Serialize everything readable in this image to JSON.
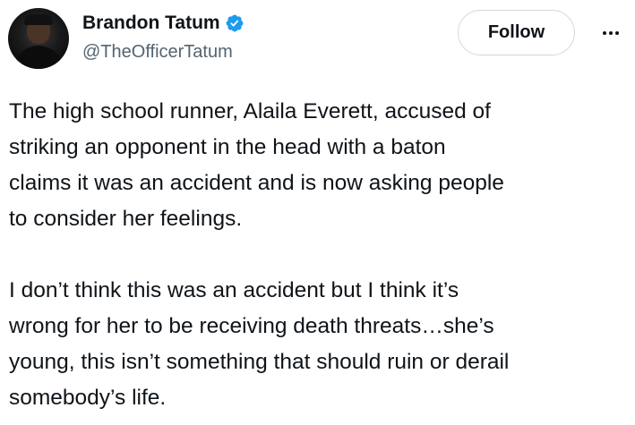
{
  "author": {
    "display_name": "Brandon Tatum",
    "handle": "@TheOfficerTatum",
    "verified": true,
    "verified_color": "#1d9bf0"
  },
  "actions": {
    "follow_label": "Follow",
    "more_icon": "more-horizontal-icon"
  },
  "tweet": {
    "paragraphs": [
      {
        "lines": [
          "The high school runner, Alaila Everett, accused of",
          "striking an opponent in the head with a baton",
          "claims it was an accident and is now asking people",
          "to consider her feelings."
        ]
      },
      {
        "lines": [
          "I don’t think this was an accident but I think it’s",
          "wrong for her to be receiving death threats…she’s",
          "young, this isn’t something that should ruin or derail",
          "somebody’s life."
        ]
      }
    ]
  },
  "colors": {
    "text_primary": "#0f1419",
    "text_secondary": "#536471",
    "border": "#cfd9de"
  }
}
